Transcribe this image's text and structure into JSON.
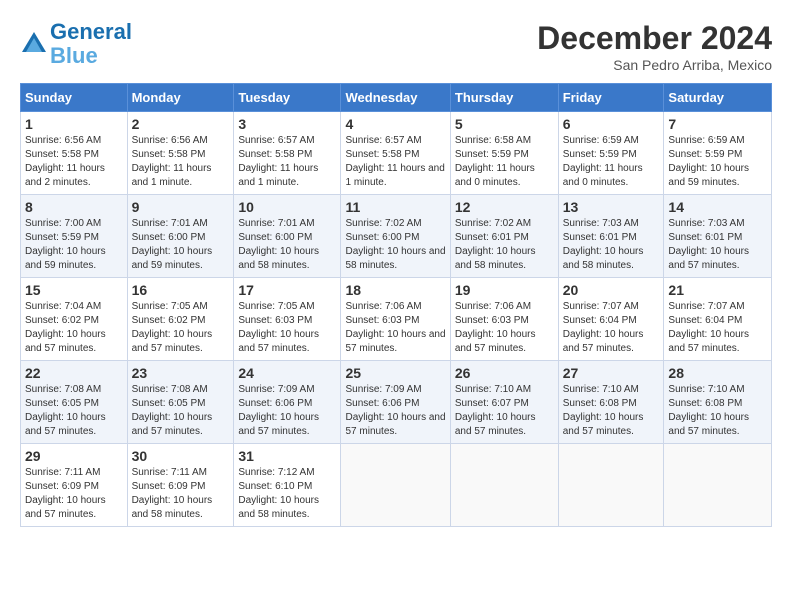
{
  "header": {
    "logo_line1": "General",
    "logo_line2": "Blue",
    "month": "December 2024",
    "location": "San Pedro Arriba, Mexico"
  },
  "days_of_week": [
    "Sunday",
    "Monday",
    "Tuesday",
    "Wednesday",
    "Thursday",
    "Friday",
    "Saturday"
  ],
  "weeks": [
    [
      {
        "day": "1",
        "sunrise": "6:56 AM",
        "sunset": "5:58 PM",
        "daylight": "11 hours and 2 minutes."
      },
      {
        "day": "2",
        "sunrise": "6:56 AM",
        "sunset": "5:58 PM",
        "daylight": "11 hours and 1 minute."
      },
      {
        "day": "3",
        "sunrise": "6:57 AM",
        "sunset": "5:58 PM",
        "daylight": "11 hours and 1 minute."
      },
      {
        "day": "4",
        "sunrise": "6:57 AM",
        "sunset": "5:58 PM",
        "daylight": "11 hours and 1 minute."
      },
      {
        "day": "5",
        "sunrise": "6:58 AM",
        "sunset": "5:59 PM",
        "daylight": "11 hours and 0 minutes."
      },
      {
        "day": "6",
        "sunrise": "6:59 AM",
        "sunset": "5:59 PM",
        "daylight": "11 hours and 0 minutes."
      },
      {
        "day": "7",
        "sunrise": "6:59 AM",
        "sunset": "5:59 PM",
        "daylight": "10 hours and 59 minutes."
      }
    ],
    [
      {
        "day": "8",
        "sunrise": "7:00 AM",
        "sunset": "5:59 PM",
        "daylight": "10 hours and 59 minutes."
      },
      {
        "day": "9",
        "sunrise": "7:01 AM",
        "sunset": "6:00 PM",
        "daylight": "10 hours and 59 minutes."
      },
      {
        "day": "10",
        "sunrise": "7:01 AM",
        "sunset": "6:00 PM",
        "daylight": "10 hours and 58 minutes."
      },
      {
        "day": "11",
        "sunrise": "7:02 AM",
        "sunset": "6:00 PM",
        "daylight": "10 hours and 58 minutes."
      },
      {
        "day": "12",
        "sunrise": "7:02 AM",
        "sunset": "6:01 PM",
        "daylight": "10 hours and 58 minutes."
      },
      {
        "day": "13",
        "sunrise": "7:03 AM",
        "sunset": "6:01 PM",
        "daylight": "10 hours and 58 minutes."
      },
      {
        "day": "14",
        "sunrise": "7:03 AM",
        "sunset": "6:01 PM",
        "daylight": "10 hours and 57 minutes."
      }
    ],
    [
      {
        "day": "15",
        "sunrise": "7:04 AM",
        "sunset": "6:02 PM",
        "daylight": "10 hours and 57 minutes."
      },
      {
        "day": "16",
        "sunrise": "7:05 AM",
        "sunset": "6:02 PM",
        "daylight": "10 hours and 57 minutes."
      },
      {
        "day": "17",
        "sunrise": "7:05 AM",
        "sunset": "6:03 PM",
        "daylight": "10 hours and 57 minutes."
      },
      {
        "day": "18",
        "sunrise": "7:06 AM",
        "sunset": "6:03 PM",
        "daylight": "10 hours and 57 minutes."
      },
      {
        "day": "19",
        "sunrise": "7:06 AM",
        "sunset": "6:03 PM",
        "daylight": "10 hours and 57 minutes."
      },
      {
        "day": "20",
        "sunrise": "7:07 AM",
        "sunset": "6:04 PM",
        "daylight": "10 hours and 57 minutes."
      },
      {
        "day": "21",
        "sunrise": "7:07 AM",
        "sunset": "6:04 PM",
        "daylight": "10 hours and 57 minutes."
      }
    ],
    [
      {
        "day": "22",
        "sunrise": "7:08 AM",
        "sunset": "6:05 PM",
        "daylight": "10 hours and 57 minutes."
      },
      {
        "day": "23",
        "sunrise": "7:08 AM",
        "sunset": "6:05 PM",
        "daylight": "10 hours and 57 minutes."
      },
      {
        "day": "24",
        "sunrise": "7:09 AM",
        "sunset": "6:06 PM",
        "daylight": "10 hours and 57 minutes."
      },
      {
        "day": "25",
        "sunrise": "7:09 AM",
        "sunset": "6:06 PM",
        "daylight": "10 hours and 57 minutes."
      },
      {
        "day": "26",
        "sunrise": "7:10 AM",
        "sunset": "6:07 PM",
        "daylight": "10 hours and 57 minutes."
      },
      {
        "day": "27",
        "sunrise": "7:10 AM",
        "sunset": "6:08 PM",
        "daylight": "10 hours and 57 minutes."
      },
      {
        "day": "28",
        "sunrise": "7:10 AM",
        "sunset": "6:08 PM",
        "daylight": "10 hours and 57 minutes."
      }
    ],
    [
      {
        "day": "29",
        "sunrise": "7:11 AM",
        "sunset": "6:09 PM",
        "daylight": "10 hours and 57 minutes."
      },
      {
        "day": "30",
        "sunrise": "7:11 AM",
        "sunset": "6:09 PM",
        "daylight": "10 hours and 58 minutes."
      },
      {
        "day": "31",
        "sunrise": "7:12 AM",
        "sunset": "6:10 PM",
        "daylight": "10 hours and 58 minutes."
      },
      null,
      null,
      null,
      null
    ]
  ]
}
